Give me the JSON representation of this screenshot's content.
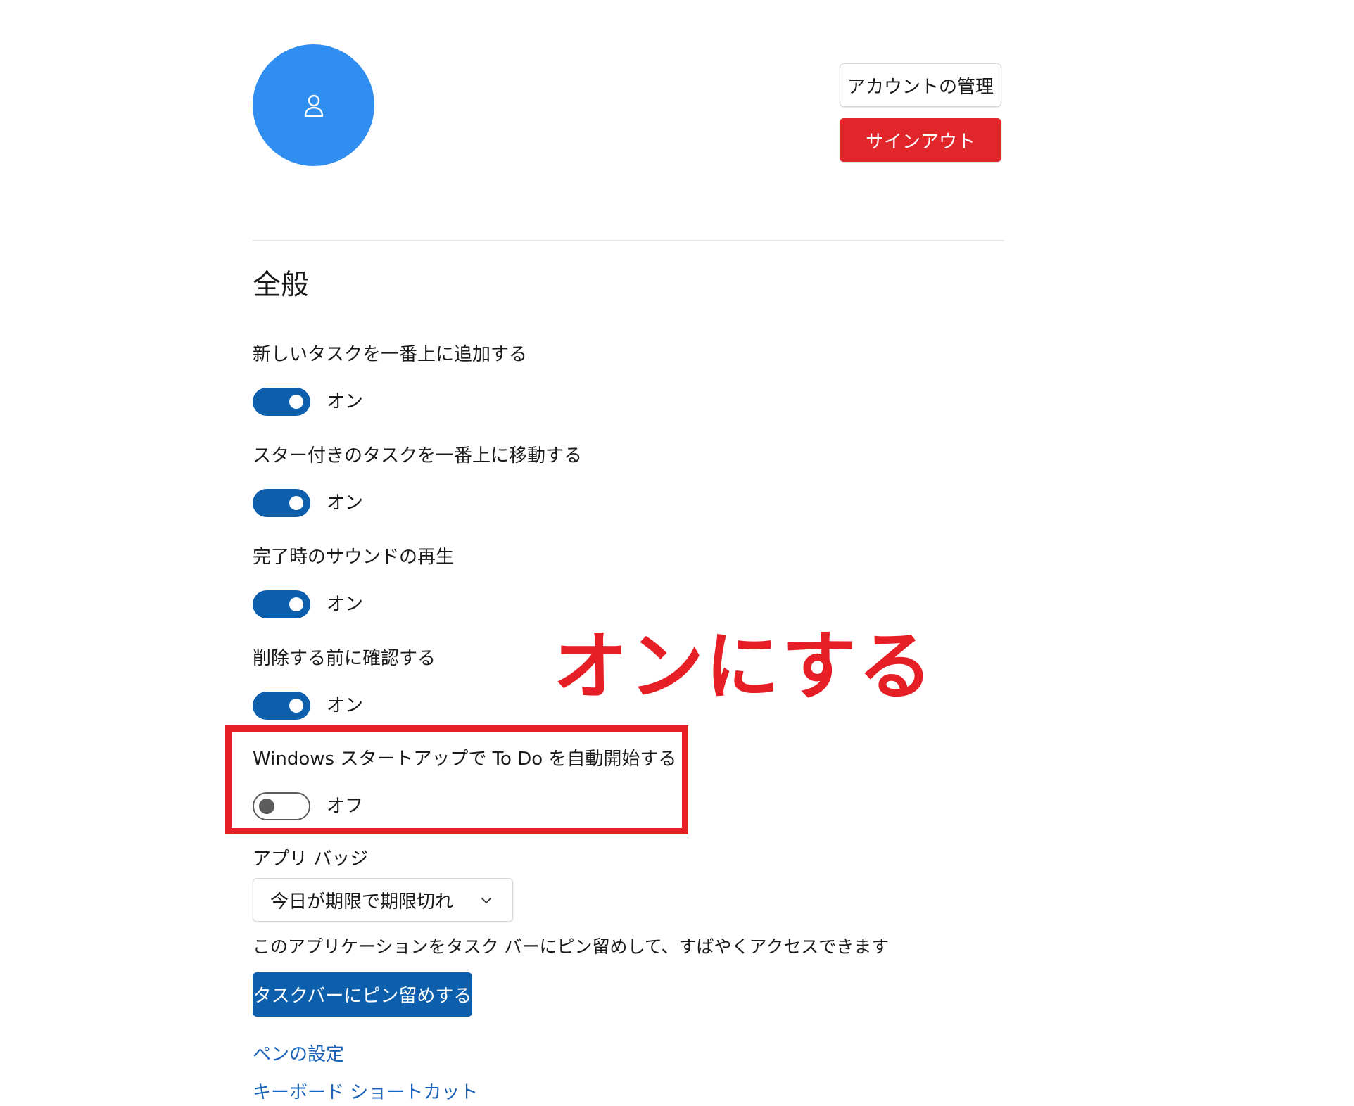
{
  "account": {
    "manage_label": "アカウントの管理",
    "signout_label": "サインアウト",
    "avatar_icon": "person-icon",
    "avatar_color": "#2f8ef0",
    "signout_color": "#e0262b"
  },
  "general": {
    "title": "全般",
    "settings": [
      {
        "label": "新しいタスクを一番上に追加する",
        "state": "オン"
      },
      {
        "label": "スター付きのタスクを一番上に移動する",
        "state": "オン"
      },
      {
        "label": "完了時のサウンドの再生",
        "state": "オン"
      },
      {
        "label": "削除する前に確認する",
        "state": "オン"
      },
      {
        "label": "Windows スタートアップで To Do を自動開始する",
        "state": "オフ"
      }
    ],
    "toggle_on_color": "#0d5eab"
  },
  "annotation": {
    "text": "オンにする",
    "color": "#e61e25"
  },
  "badge": {
    "label": "アプリ バッジ",
    "selected": "今日が期限で期限切れ"
  },
  "pin": {
    "description": "このアプリケーションをタスク バーにピン留めして、すばやくアクセスできます",
    "button_label": "タスクバーにピン留めする"
  },
  "links": {
    "pen_settings": "ペンの設定",
    "keyboard_shortcuts": "キーボード ショートカット",
    "link_color": "#1a63b8"
  }
}
